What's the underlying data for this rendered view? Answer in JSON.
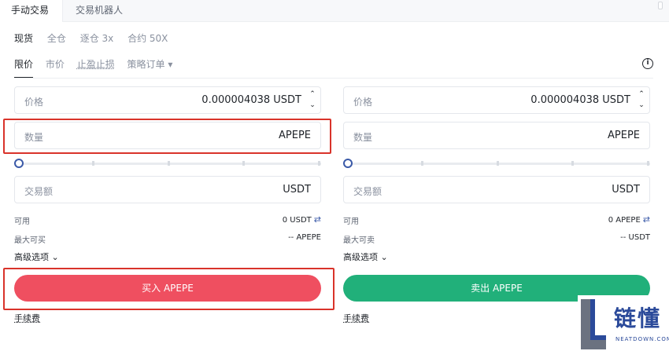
{
  "tabs": {
    "manual": "手动交易",
    "bot": "交易机器人"
  },
  "modes": [
    "现货",
    "全仓",
    "逐仓 3x",
    "合约 50X"
  ],
  "order_types": {
    "limit": "限价",
    "market": "市价",
    "tpsl": "止盈止损",
    "strategy": "策略订单 ▾"
  },
  "buy": {
    "price_label": "价格",
    "price_value": "0.000004038 USDT",
    "qty_label": "数量",
    "qty_value": "APEPE",
    "amount_label": "交易额",
    "amount_value": "USDT",
    "avail_label": "可用",
    "avail_value": "0 USDT",
    "max_label": "最大可买",
    "max_value": "-- APEPE",
    "advanced": "高级选项 ⌄",
    "button": "买入 APEPE",
    "fee": "手续费"
  },
  "sell": {
    "price_label": "价格",
    "price_value": "0.000004038 USDT",
    "qty_label": "数量",
    "qty_value": "APEPE",
    "amount_label": "交易额",
    "amount_value": "USDT",
    "avail_label": "可用",
    "avail_value": "0 APEPE",
    "max_label": "最大可卖",
    "max_value": "-- USDT",
    "advanced": "高级选项 ⌄",
    "button": "卖出 APEPE",
    "fee": "手续费"
  },
  "watermark": {
    "text": "链懂",
    "sub": "NEATDOWN.COM"
  },
  "colors": {
    "buy": "#ef4f60",
    "sell": "#21b07a",
    "highlight": "#d9332a"
  },
  "icons": {
    "swap": "⇄",
    "step_up": "⌃",
    "step_down": "⌄",
    "info": "i"
  }
}
